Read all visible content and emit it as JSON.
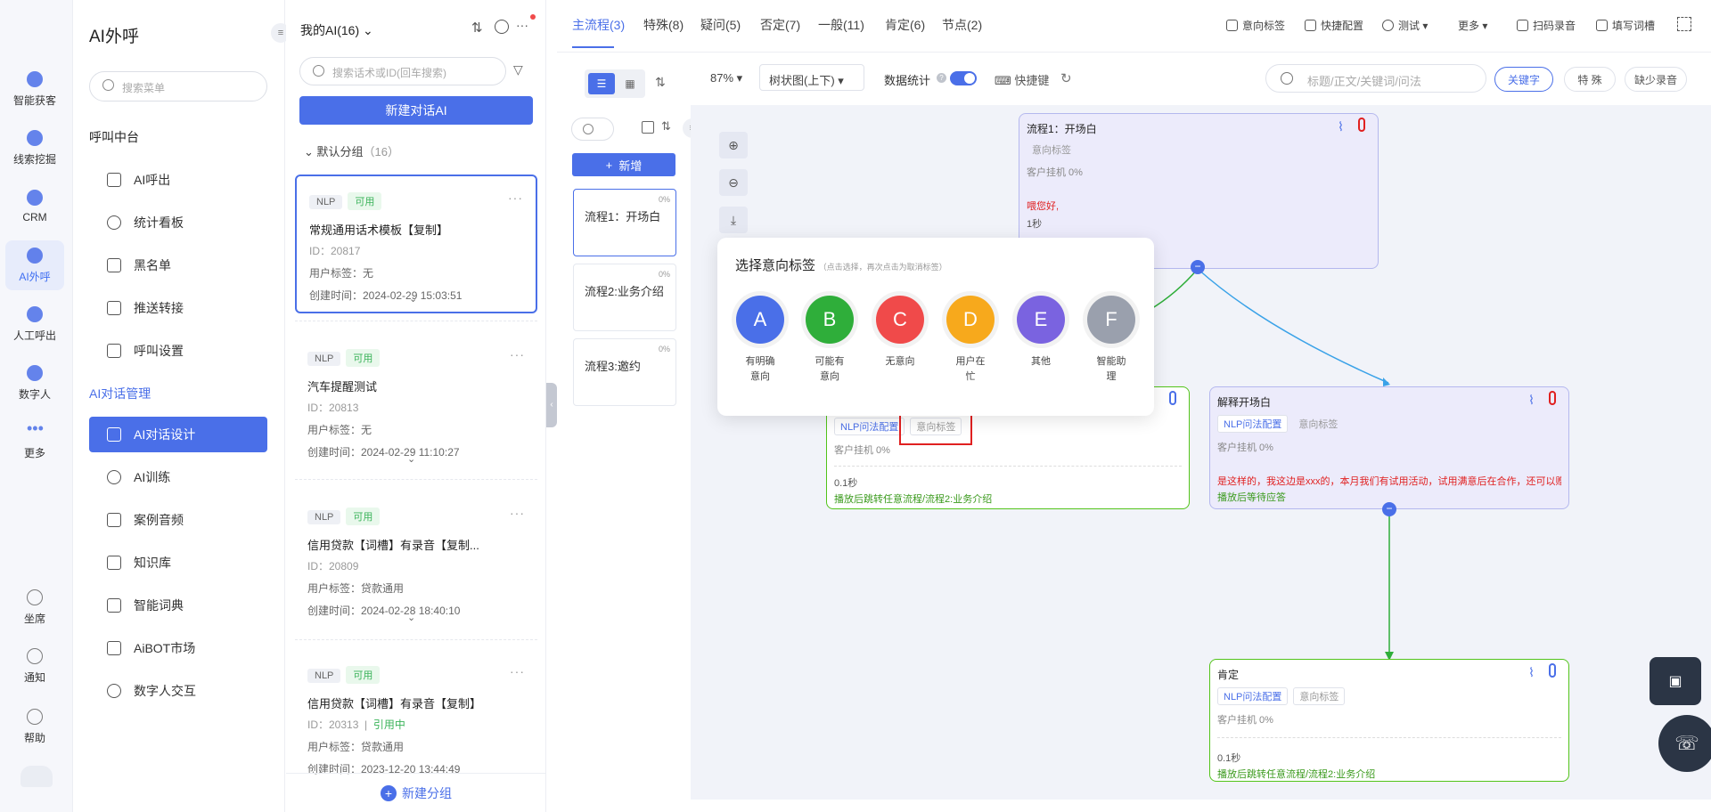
{
  "rail": [
    {
      "label": "智能获客",
      "icon": "target-icon"
    },
    {
      "label": "线索挖掘",
      "icon": "clue-icon"
    },
    {
      "label": "CRM",
      "icon": "crm-icon"
    },
    {
      "label": "AI外呼",
      "icon": "ai-call-icon"
    },
    {
      "label": "人工呼出",
      "icon": "manual-call-icon"
    },
    {
      "label": "数字人",
      "icon": "digital-human-icon"
    },
    {
      "label": "更多",
      "icon": "more-dots-icon"
    },
    {
      "label": "坐席",
      "icon": "headset-icon"
    },
    {
      "label": "通知",
      "icon": "bell-icon"
    },
    {
      "label": "帮助",
      "icon": "help-icon"
    }
  ],
  "menu": {
    "title": "AI外呼",
    "search_placeholder": "搜索菜单",
    "section1": "呼叫中台",
    "items1": [
      "AI呼出",
      "统计看板",
      "黑名单",
      "推送转接",
      "呼叫设置"
    ],
    "section2": "AI对话管理",
    "items2": [
      "AI对话设计",
      "AI训练",
      "案例音频",
      "知识库",
      "智能词典",
      "AiBOT市场",
      "数字人交互"
    ]
  },
  "list": {
    "header": "我的AI(16)",
    "search_placeholder": "搜索话术或ID(回车搜索)",
    "new_button": "新建对话AI",
    "group": "默认分组",
    "group_count": "（16）",
    "footer": "新建分组",
    "cards": [
      {
        "tag1": "NLP",
        "tag2": "可用",
        "title": "常规通用话术模板【复制】",
        "id": "ID：20817",
        "label": "用户标签：无",
        "time": "创建时间：2024-02-29 15:03:51"
      },
      {
        "tag1": "NLP",
        "tag2": "可用",
        "title": "汽车提醒测试",
        "id": "ID：20813",
        "label": "用户标签：无",
        "time": "创建时间：2024-02-29 11:10:27"
      },
      {
        "tag1": "NLP",
        "tag2": "可用",
        "title": "信用贷款【词槽】有录音【复制...",
        "id": "ID：20809",
        "label": "用户标签：贷款通用",
        "time": "创建时间：2024-02-28 18:40:10"
      },
      {
        "tag1": "NLP",
        "tag2": "可用",
        "title": "信用贷款【词槽】有录音【复制】",
        "id": "ID：20313",
        "extra": "引用中",
        "label": "用户标签：贷款通用",
        "time": "创建时间：2023-12-20 13:44:49"
      }
    ]
  },
  "tabs": [
    "主流程(3)",
    "特殊(8)",
    "疑问(5)",
    "否定(7)",
    "一般(11)",
    "肯定(6)",
    "节点(2)"
  ],
  "toolbar": [
    "意向标签",
    "快捷配置",
    "测试",
    "更多",
    "扫码录音",
    "填写词槽"
  ],
  "flow_panel": {
    "new_button": "新增",
    "items": [
      {
        "label": "流程1：开场白",
        "pct": "0%"
      },
      {
        "label": "流程2:业务介绍",
        "pct": "0%"
      },
      {
        "label": "流程3:邀约",
        "pct": "0%"
      }
    ]
  },
  "canvas_ctrl": {
    "zoom": "87%",
    "layout": "树状图(上下)",
    "stats": "数据统计",
    "hotkey": "快捷键",
    "search_placeholder": "标题/正文/关键词/问法",
    "btn1": "关键字",
    "btn2": "特 殊",
    "btn3": "缺少录音"
  },
  "nodes": {
    "n1": {
      "title": "流程1：开场白",
      "tag": "意向标签",
      "stat": "客户挂机 0%",
      "text": "喂您好,",
      "time": "1秒"
    },
    "n2": {
      "tag1": "NLP问法配置",
      "tag2": "意向标签",
      "stat": "客户挂机 0%",
      "time": "0.1秒",
      "jump": "播放后跳转任意流程/流程2:业务介绍"
    },
    "n3": {
      "title": "解释开场白",
      "tag1": "NLP问法配置",
      "tag2": "意向标签",
      "stat": "客户挂机 0%",
      "text": "是这样的，我这边是xxx的，本月我们有试用活动，试用满意后在合作，还可以赠送",
      "wait": "播放后等待应答"
    },
    "n4": {
      "title": "肯定",
      "tag1": "NLP问法配置",
      "tag2": "意向标签",
      "stat": "客户挂机 0%",
      "time": "0.1秒",
      "jump": "播放后跳转任意流程/流程2:业务介绍"
    }
  },
  "popup": {
    "title": "选择意向标签",
    "hint": "（点击选择，再次点击为取消标签）",
    "options": [
      {
        "letter": "A",
        "line1": "有明确",
        "line2": "意向",
        "color": "#4a6fe8"
      },
      {
        "letter": "B",
        "line1": "可能有",
        "line2": "意向",
        "color": "#2fae3a"
      },
      {
        "letter": "C",
        "line1": "无意向",
        "line2": "",
        "color": "#f04a4a"
      },
      {
        "letter": "D",
        "line1": "用户在",
        "line2": "忙",
        "color": "#f7a91c"
      },
      {
        "letter": "E",
        "line1": "其他",
        "line2": "",
        "color": "#7a63e0"
      },
      {
        "letter": "F",
        "line1": "智能助",
        "line2": "理",
        "color": "#9aa0ad"
      }
    ]
  }
}
